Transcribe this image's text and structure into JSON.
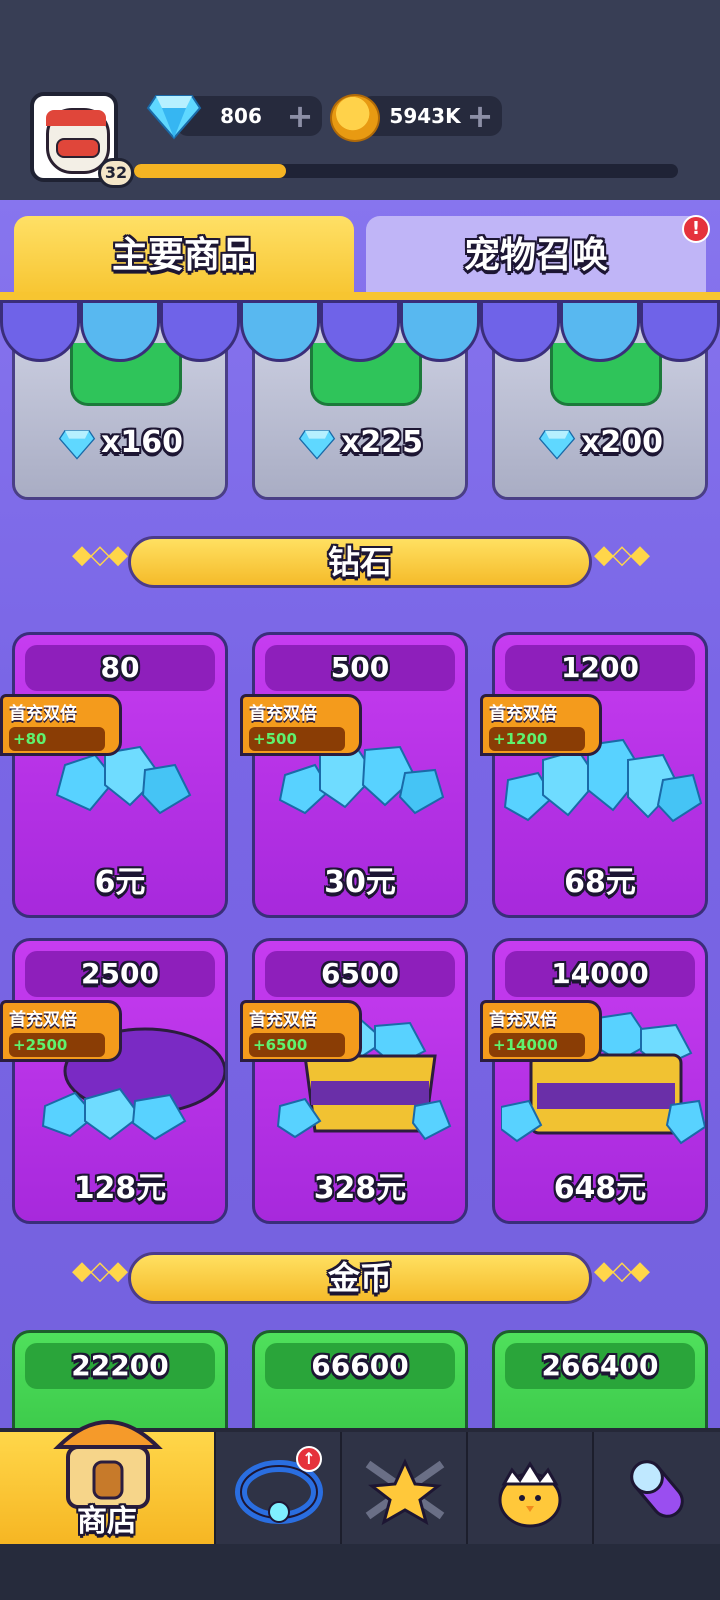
{
  "header": {
    "level": "32",
    "xp_progress": 0.28,
    "gems": "806",
    "coins": "5943K"
  },
  "tabs": [
    {
      "label": "主要商品",
      "active": true
    },
    {
      "label": "宠物召唤",
      "active": false,
      "alert": "!"
    }
  ],
  "top_offers": [
    {
      "price": "x160"
    },
    {
      "price": "x225"
    },
    {
      "price": "x200"
    }
  ],
  "sections": {
    "diamonds_title": "钻石",
    "coins_title": "金币"
  },
  "diamond_packs": [
    {
      "amount": "80",
      "bonus_label": "首充双倍",
      "bonus": "+80",
      "price": "6元"
    },
    {
      "amount": "500",
      "bonus_label": "首充双倍",
      "bonus": "+500",
      "price": "30元"
    },
    {
      "amount": "1200",
      "bonus_label": "首充双倍",
      "bonus": "+1200",
      "price": "68元"
    },
    {
      "amount": "2500",
      "bonus_label": "首充双倍",
      "bonus": "+2500",
      "price": "128元"
    },
    {
      "amount": "6500",
      "bonus_label": "首充双倍",
      "bonus": "+6500",
      "price": "328元"
    },
    {
      "amount": "14000",
      "bonus_label": "首充双倍",
      "bonus": "+14000",
      "price": "648元"
    }
  ],
  "coin_packs": [
    {
      "amount": "22200"
    },
    {
      "amount": "66600"
    },
    {
      "amount": "266400"
    }
  ],
  "bottom_nav": {
    "shop_label": "商店",
    "items": [
      "shop-icon",
      "ring-icon",
      "star-weapons-icon",
      "egg-chick-icon",
      "capsule-icon"
    ],
    "ring_badge": "↑"
  },
  "colors": {
    "accent": "#f7c531",
    "purple_bg": "#7a66e6",
    "card_magenta": "#b52fe6",
    "green_card": "#43d150"
  }
}
